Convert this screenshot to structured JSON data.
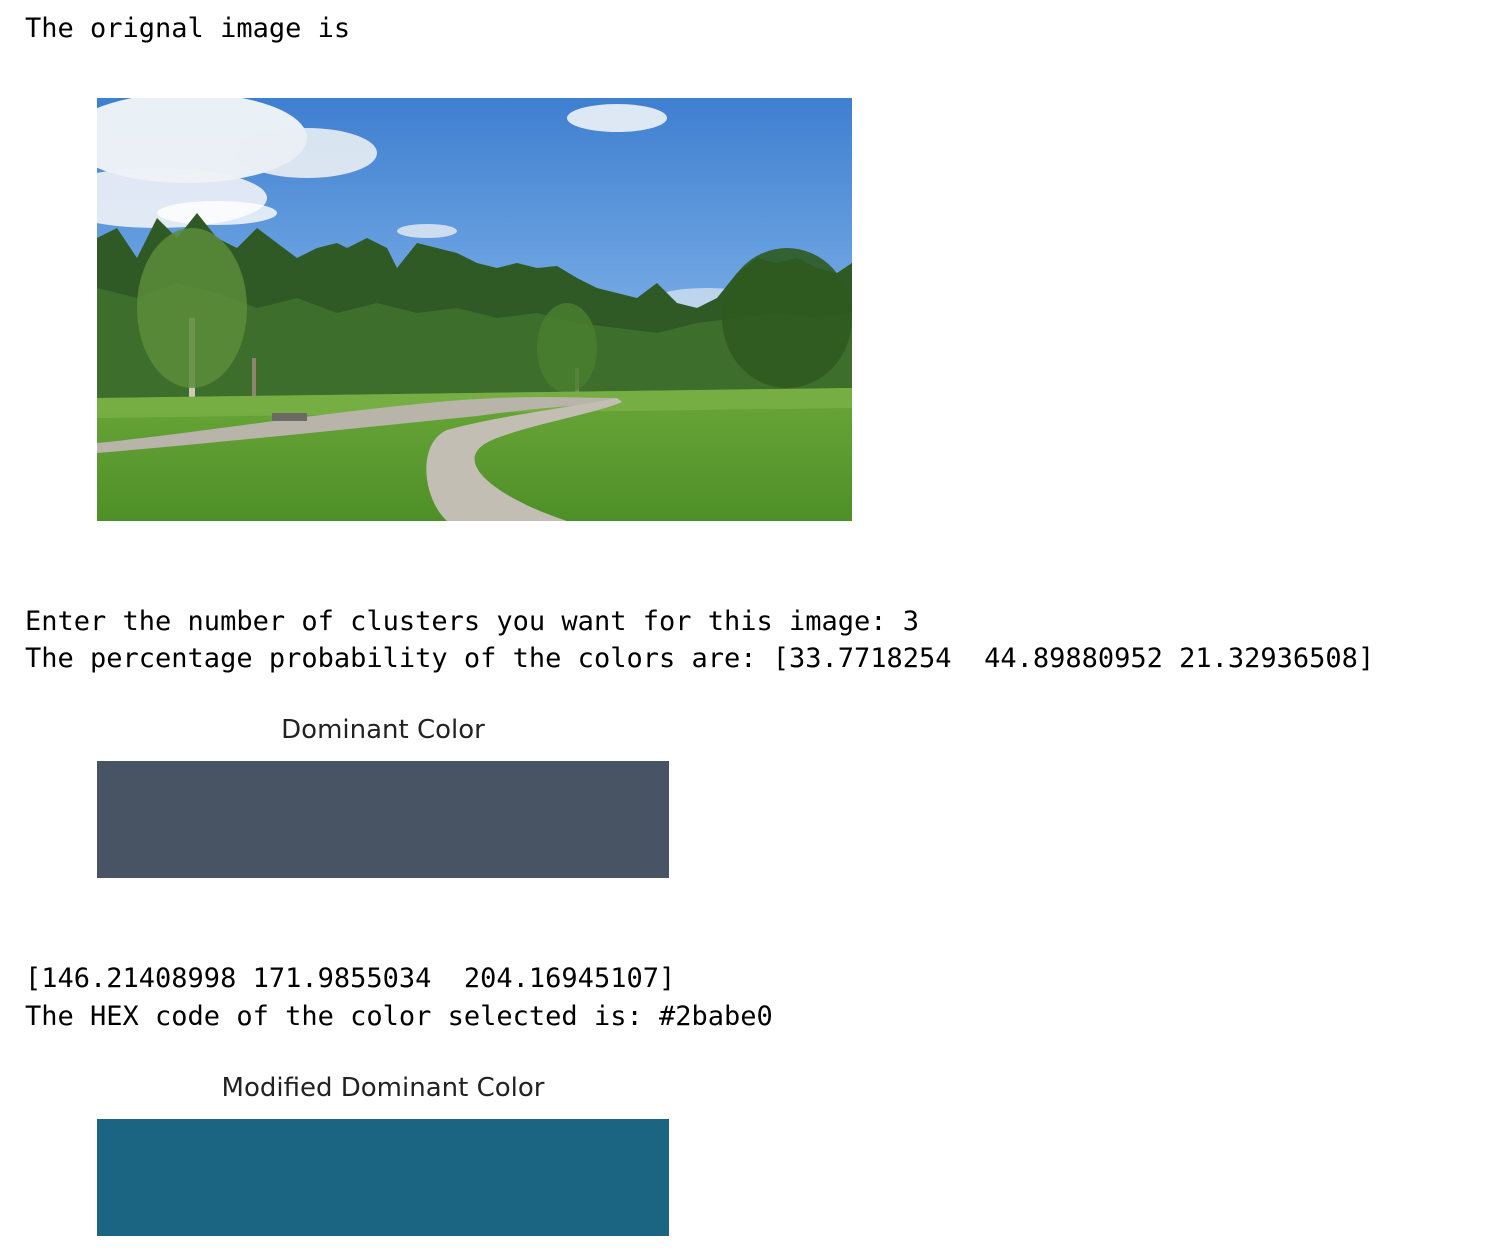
{
  "output": {
    "line1": "The orignal image is",
    "line2": "Enter the number of clusters you want for this image: 3",
    "line3": "The percentage probability of the colors are: [33.7718254  44.89880952 21.32936508]",
    "line4": "[146.21408998 171.9855034  204.16945107]",
    "line5": "The HEX code of the color selected is: #2babe0"
  },
  "dominant": {
    "title": "Dominant Color",
    "color": "#485463"
  },
  "modified": {
    "title": "Modified Dominant Color",
    "color": "#1b6583"
  },
  "image": {
    "description_icon": "park-landscape-image"
  }
}
